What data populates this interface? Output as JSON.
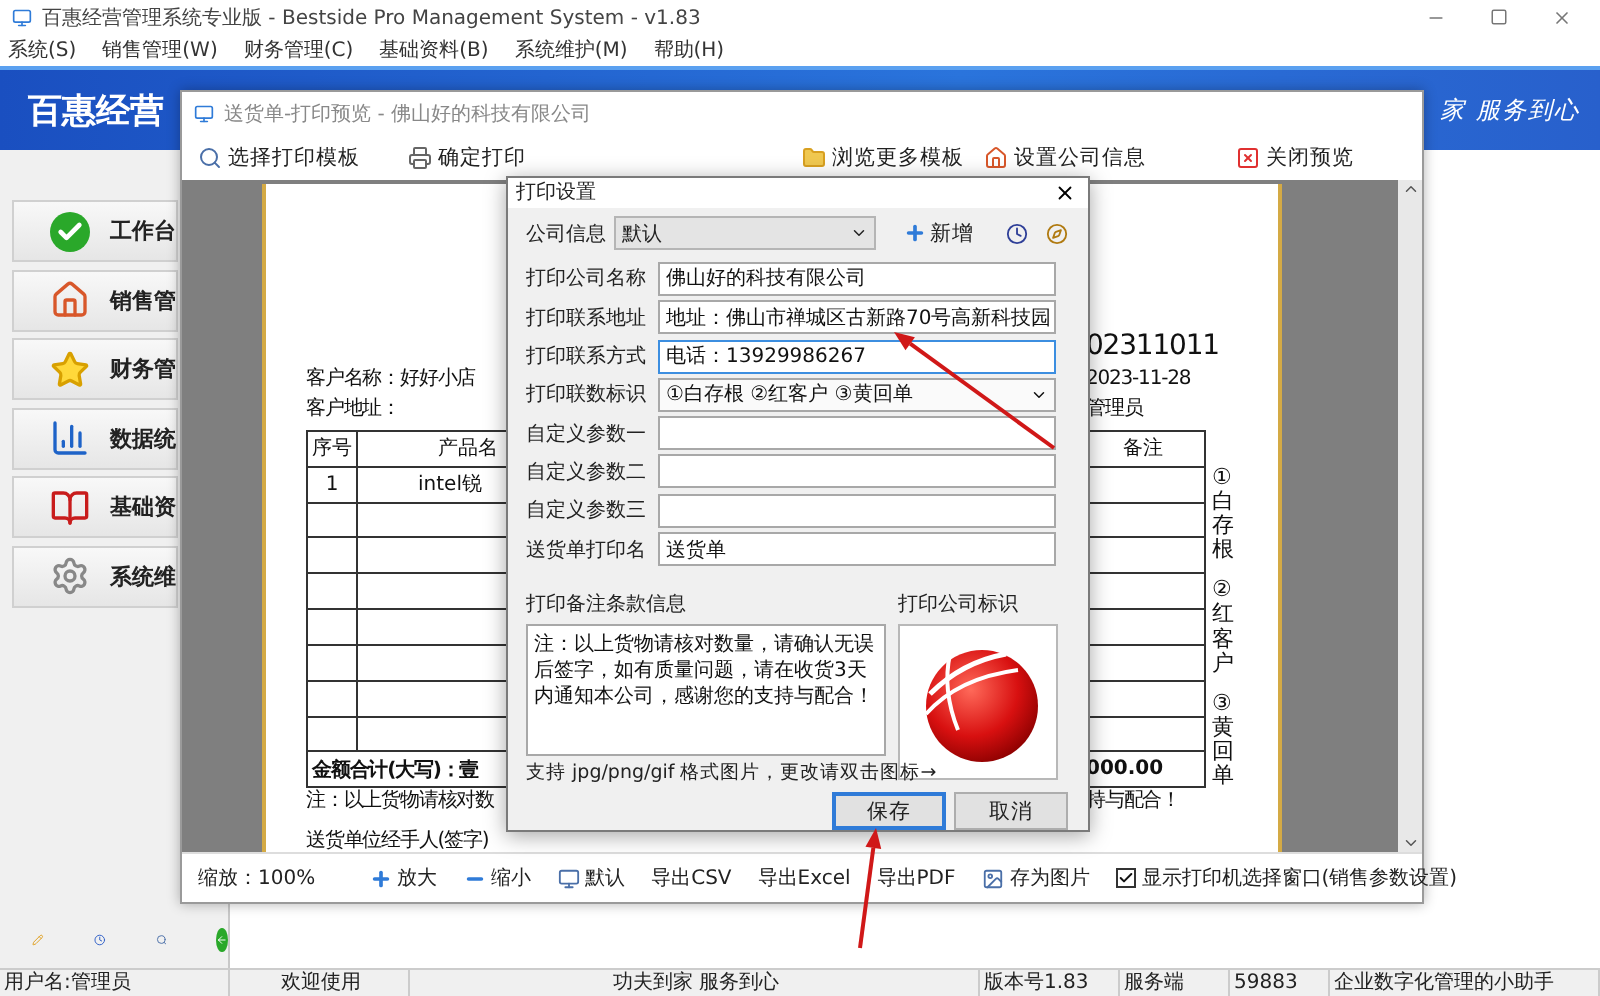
{
  "window": {
    "title": "百惠经营管理系统专业版 - Bestside Pro Management System - v1.83"
  },
  "menu": [
    "系统(S)",
    "销售管理(W)",
    "财务管理(C)",
    "基础资料(B)",
    "系统维护(M)",
    "帮助(H)"
  ],
  "banner": {
    "title": "百惠经营",
    "slogan": "家 服务到心"
  },
  "sidebar": {
    "items": [
      "工作台",
      "销售管",
      "财务管",
      "数据统",
      "基础资",
      "系统维"
    ]
  },
  "preview": {
    "title": "送货单-打印预览 - 佛山好的科技有限公司",
    "toolbar": [
      "选择打印模板",
      "确定打印",
      "浏览更多模板",
      "设置公司信息",
      "关闭预览"
    ],
    "paper": {
      "order_no": "02311011",
      "customer_name": "客户名称：好好小店",
      "date": "2023-11-28",
      "customer_address": "客户地址：",
      "operator": "管理员",
      "columns": [
        "序号",
        "产品名",
        "备注"
      ],
      "rows": [
        [
          "1",
          "intel锐"
        ]
      ],
      "total_label": "金额合计(大写)：壹",
      "total_value": "000.00",
      "copies": [
        "①白存根",
        "②红客户",
        "③黄回单"
      ],
      "note_left": "注：以上货物请核对数",
      "note_right": "持与配合！",
      "signature": "送货单位经手人(签字)"
    },
    "bottom_bar": {
      "zoom": "缩放：100%",
      "buttons": [
        "放大",
        "缩小",
        "默认",
        "导出CSV",
        "导出Excel",
        "导出PDF",
        "存为图片"
      ],
      "printer_option": {
        "label": "显示打印机选择窗口(销售参数设置)",
        "checked": true
      }
    }
  },
  "dialog": {
    "title": "打印设置",
    "company_label": "公司信息",
    "company_value": "默认",
    "add_label": "新增",
    "fields": [
      {
        "kind": "text",
        "label": "打印公司名称",
        "value": "佛山好的科技有限公司",
        "focused": false
      },
      {
        "kind": "text",
        "label": "打印联系地址",
        "value": "地址：佛山市禅城区古新路70号高新科技园",
        "focused": false
      },
      {
        "kind": "text",
        "label": "打印联系方式",
        "value": "电话：13929986267",
        "focused": true
      },
      {
        "kind": "select",
        "label": "打印联数标识",
        "value": "①白存根 ②红客户 ③黄回单",
        "focused": false
      },
      {
        "kind": "text",
        "label": "自定义参数一",
        "focused": false
      },
      {
        "kind": "text",
        "label": "自定义参数二",
        "focused": false
      },
      {
        "kind": "text",
        "label": "自定义参数三",
        "focused": false
      },
      {
        "kind": "text",
        "label": "送货单打印名",
        "value": "送货单",
        "focused": false
      }
    ],
    "remarks_label": "打印备注条款信息",
    "remarks": "注：以上货物请核对数量，请确认无误后签字，如有质量问题，请在收货3天内通知本公司，感谢您的支持与配合！",
    "logo_label": "打印公司标识",
    "hint": "支持 jpg/png/gif 格式图片，更改请双击图标→",
    "buttons": [
      {
        "label": "保存",
        "focused": true
      },
      {
        "label": "取消",
        "focused": false
      }
    ]
  },
  "status_bar": [
    "用户名:管理员",
    "欢迎使用",
    "功夫到家 服务到心",
    "版本号1.83",
    "服务端",
    "59883",
    "企业数字化管理的小助手"
  ]
}
